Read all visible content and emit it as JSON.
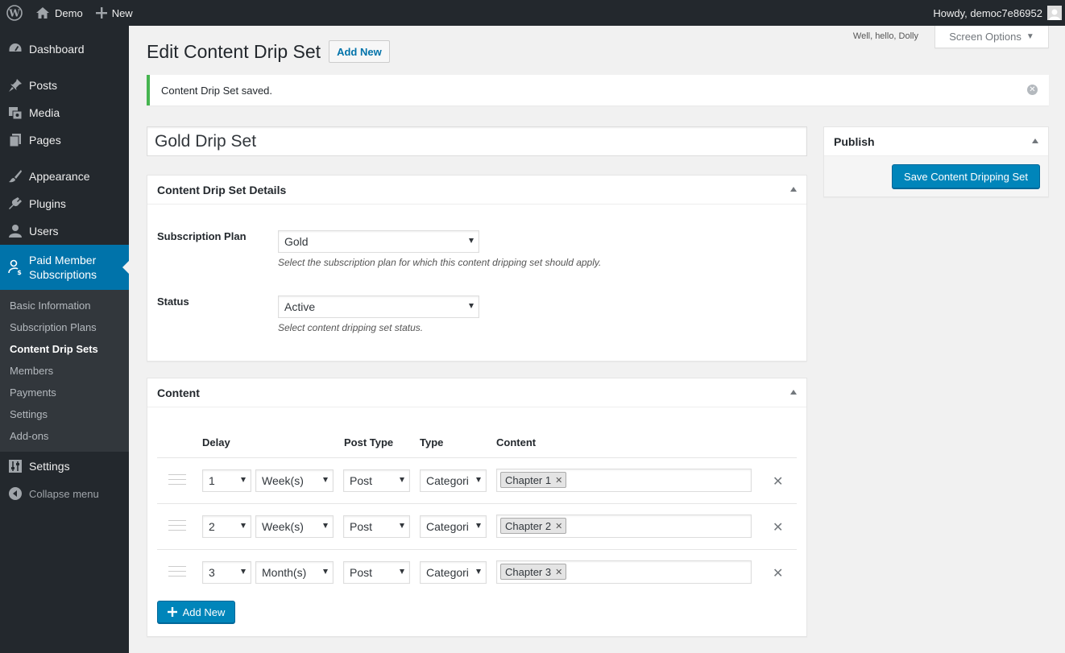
{
  "adminbar": {
    "site_name": "Demo",
    "new_label": "New",
    "howdy": "Howdy, democ7e86952"
  },
  "sidebar": {
    "items": [
      {
        "label": "Dashboard",
        "icon": "dashboard-icon"
      },
      {
        "label": "Posts",
        "icon": "pin-icon"
      },
      {
        "label": "Media",
        "icon": "media-icon"
      },
      {
        "label": "Pages",
        "icon": "pages-icon"
      },
      {
        "label": "Appearance",
        "icon": "brush-icon"
      },
      {
        "label": "Plugins",
        "icon": "plug-icon"
      },
      {
        "label": "Users",
        "icon": "user-icon"
      },
      {
        "label": "Paid Member Subscriptions",
        "label_line1": "Paid Member",
        "label_line2": "Subscriptions",
        "icon": "member-icon"
      }
    ],
    "submenu": [
      "Basic Information",
      "Subscription Plans",
      "Content Drip Sets",
      "Members",
      "Payments",
      "Settings",
      "Add-ons"
    ],
    "settings_label": "Settings",
    "collapse_label": "Collapse menu"
  },
  "header": {
    "dolly": "Well, hello, Dolly",
    "screen_options": "Screen Options",
    "title": "Edit Content Drip Set",
    "add_new": "Add New"
  },
  "notice": {
    "message": "Content Drip Set saved."
  },
  "post_title": "Gold Drip Set",
  "details": {
    "heading": "Content Drip Set Details",
    "subscription_plan_label": "Subscription Plan",
    "subscription_plan_value": "Gold",
    "subscription_plan_desc": "Select the subscription plan for which this content dripping set should apply.",
    "status_label": "Status",
    "status_value": "Active",
    "status_desc": "Select content dripping set status."
  },
  "content_box": {
    "heading": "Content",
    "columns": {
      "delay": "Delay",
      "post_type": "Post Type",
      "type": "Type",
      "content": "Content"
    },
    "rows": [
      {
        "delay": "1",
        "unit": "Week(s)",
        "post_type": "Post",
        "type": "Categori",
        "tag": "Chapter 1"
      },
      {
        "delay": "2",
        "unit": "Week(s)",
        "post_type": "Post",
        "type": "Categori",
        "tag": "Chapter 2"
      },
      {
        "delay": "3",
        "unit": "Month(s)",
        "post_type": "Post",
        "type": "Categori",
        "tag": "Chapter 3"
      }
    ],
    "add_new": "Add New"
  },
  "publish": {
    "heading": "Publish",
    "save_button": "Save Content Dripping Set"
  },
  "colors": {
    "accent": "#0073aa",
    "primary_button": "#0085ba",
    "success": "#46b450",
    "sidebar_bg": "#23282d"
  }
}
